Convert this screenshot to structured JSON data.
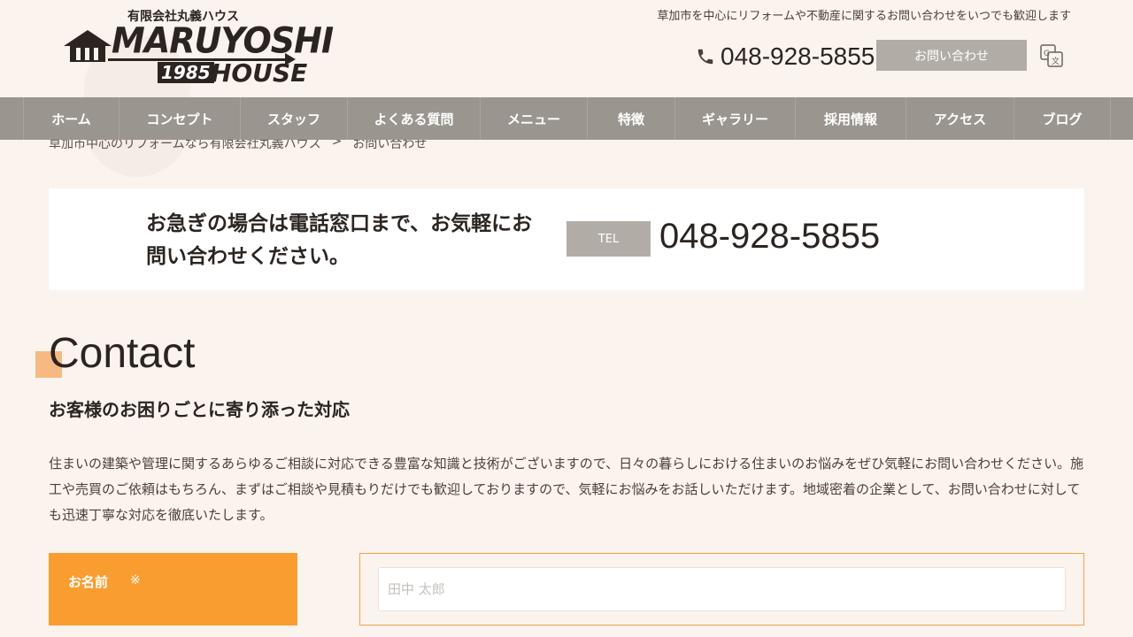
{
  "header": {
    "logo_sub": "有限会社丸義ハウス",
    "logo_main": "MARUYOSHI",
    "logo_year": "1985",
    "logo_house": "HOUSE",
    "tagline": "草加市を中心にリフォームや不動産に関するお問い合わせをいつでも歓迎します",
    "phone": "048-928-5855",
    "contact_button": "お問い合わせ"
  },
  "nav": {
    "items": [
      {
        "label": "ホーム"
      },
      {
        "label": "コンセプト"
      },
      {
        "label": "スタッフ"
      },
      {
        "label": "よくある質問"
      },
      {
        "label": "メニュー"
      },
      {
        "label": "特徴"
      },
      {
        "label": "ギャラリー"
      },
      {
        "label": "採用情報"
      },
      {
        "label": "アクセス"
      },
      {
        "label": "ブログ"
      }
    ]
  },
  "breadcrumb": {
    "home": "草加市中心のリフォームなら有限会社丸義ハウス",
    "separator": ">",
    "current": "お問い合わせ"
  },
  "tel_box": {
    "message_line1": "お急ぎの場合は電話窓口まで、お気軽にお",
    "message_line2": "問い合わせください。",
    "badge": "TEL",
    "number": "048-928-5855"
  },
  "main": {
    "heading": "Contact",
    "subtitle": "お客様のお困りごとに寄り添った対応",
    "intro": "住まいの建築や管理に関するあらゆるご相談に対応できる豊富な知識と技術がございますので、日々の暮らしにおける住まいのお悩みをぜひ気軽にお問い合わせください。施工や売買のご依頼はもちろん、まずはご相談や見積もりだけでも歓迎しておりますので、気軽にお悩みをお話しいただけます。地域密着の企業として、お問い合わせに対しても迅速丁寧な対応を徹底いたします。"
  },
  "form": {
    "name_label": "お名前",
    "required_mark": "※",
    "name_placeholder": "田中 太郎",
    "name_value": ""
  },
  "colors": {
    "background": "#fbf3ee",
    "nav": "#9a958f",
    "accent": "#f99d31",
    "button_gray": "#b2aca7"
  }
}
